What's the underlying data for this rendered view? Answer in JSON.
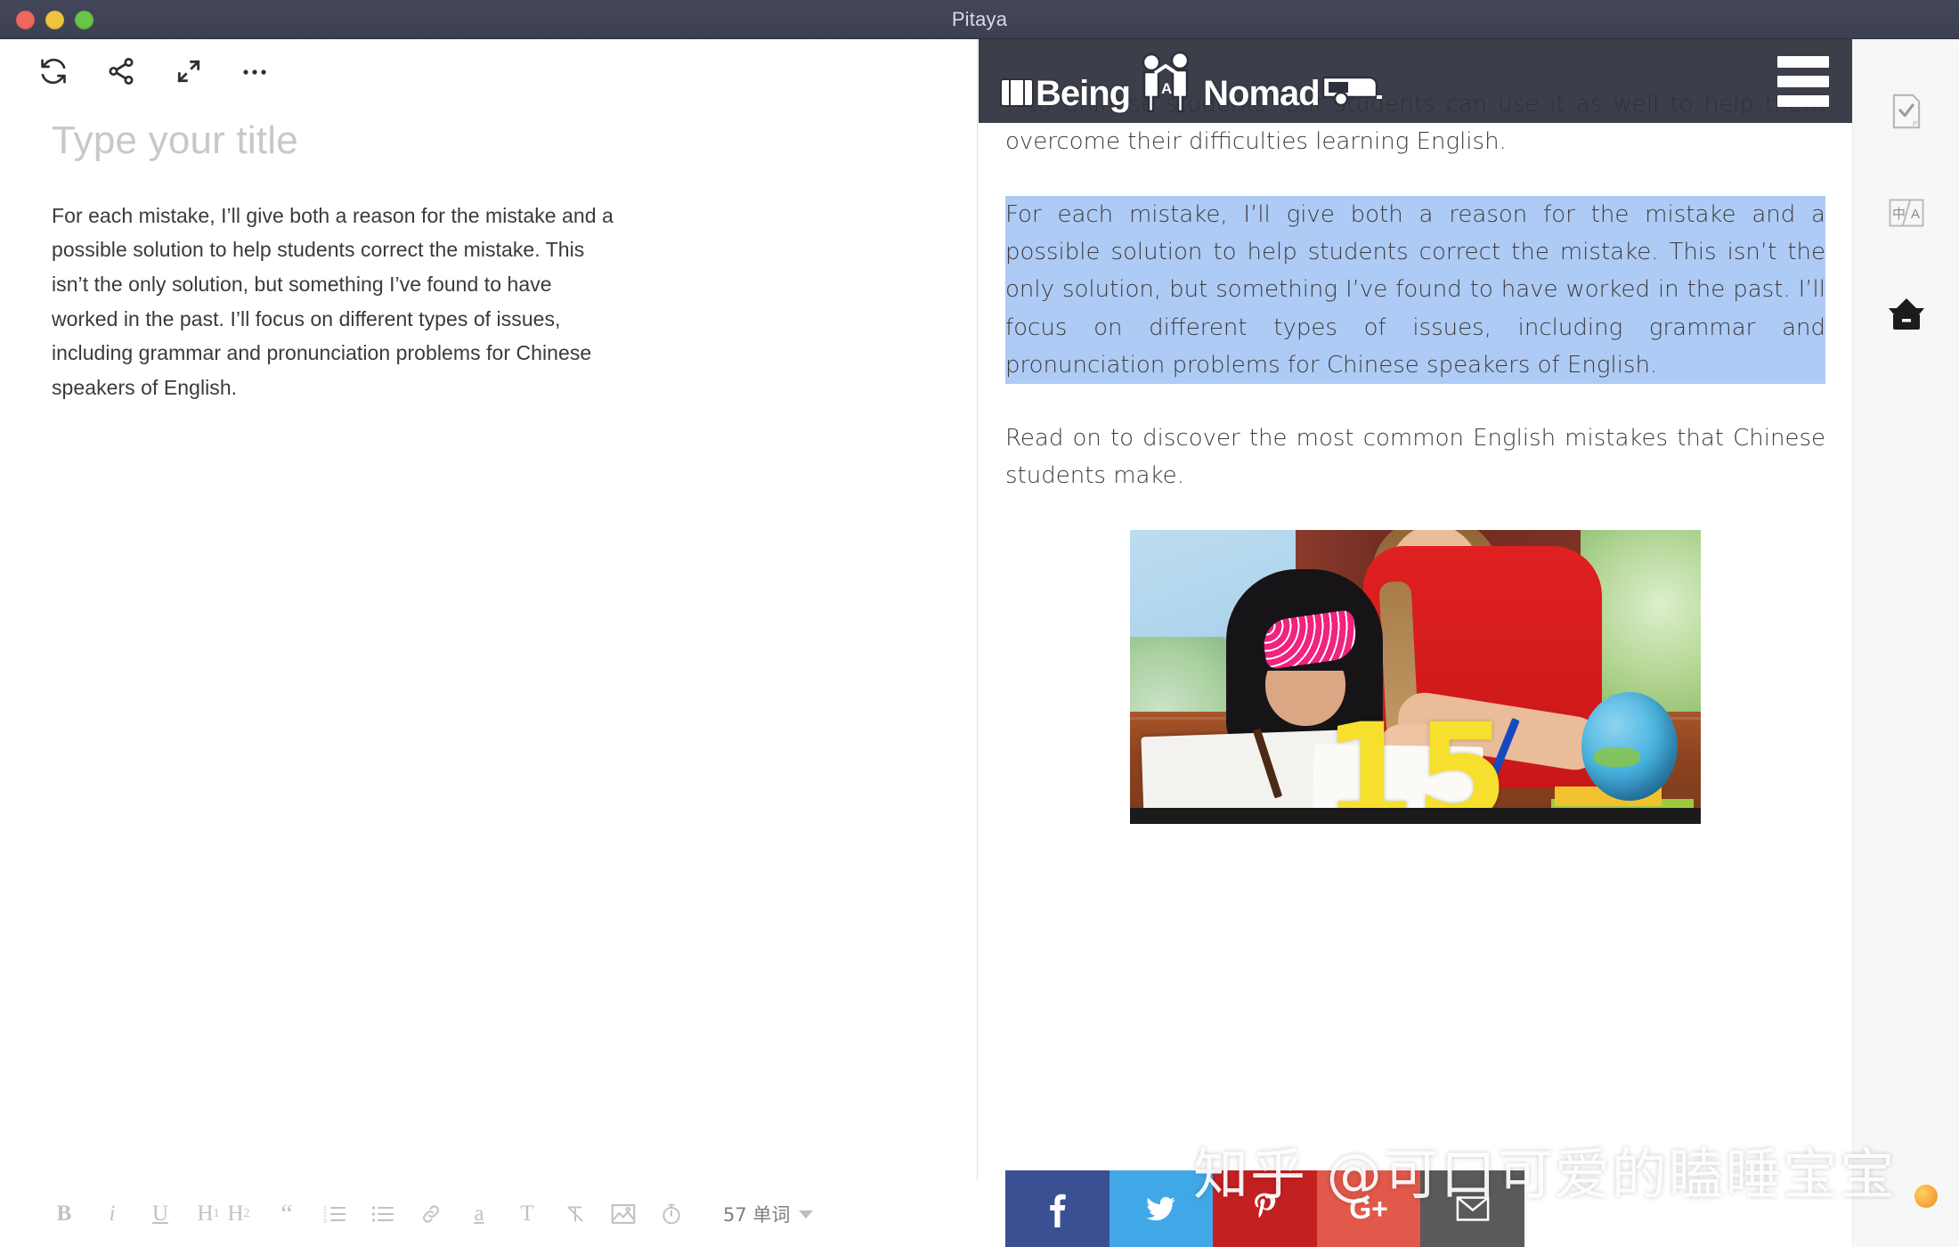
{
  "window": {
    "title": "Pitaya",
    "traffic_lights": [
      "close",
      "minimize",
      "zoom"
    ]
  },
  "editor": {
    "toolbar": [
      {
        "name": "sync-icon",
        "label": "Sync"
      },
      {
        "name": "share-icon",
        "label": "Share"
      },
      {
        "name": "fullscreen-icon",
        "label": "Fullscreen"
      },
      {
        "name": "more-icon",
        "label": "More"
      }
    ],
    "title_placeholder": "Type your title",
    "title_value": "",
    "paragraph": "For each mistake, I’ll give both a reason for the mistake and a possible solution to help students correct the mistake. This isn’t the only solution, but something I’ve found to have worked in the past. I’ll focus on different types of issues, including grammar and pronunciation problems for Chinese speakers of English."
  },
  "format_bar": {
    "items": [
      {
        "name": "bold-button",
        "label": "B"
      },
      {
        "name": "italic-button",
        "label": "i"
      },
      {
        "name": "underline-button",
        "label": "U"
      },
      {
        "name": "heading1-button",
        "label": "H1"
      },
      {
        "name": "heading2-button",
        "label": "H2"
      },
      {
        "name": "blockquote-button",
        "label": "“"
      },
      {
        "name": "ordered-list-button",
        "label": "ordered-list"
      },
      {
        "name": "bullet-list-button",
        "label": "bullet-list"
      },
      {
        "name": "link-button",
        "label": "link"
      },
      {
        "name": "strikethrough-button",
        "label": "a"
      },
      {
        "name": "text-style-button",
        "label": "T"
      },
      {
        "name": "clear-format-button",
        "label": "clear-format"
      },
      {
        "name": "insert-image-button",
        "label": "image"
      },
      {
        "name": "timer-button",
        "label": "timer"
      }
    ],
    "word_count": "57 单词"
  },
  "preview": {
    "site_header": {
      "logo_text_1": "Being",
      "logo_text_2": "Nomad",
      "logo_letter": "A",
      "menu_icon": "hamburger-icon"
    },
    "paragraphs": [
      {
        "id": "para-occluded",
        "text": "…to Chinese students. But students can use it as well to help them overcome their difficulties learning English.",
        "selected": false
      },
      {
        "id": "para-selected",
        "text": "For each mistake, I’ll give both a reason for the mistake and a possible solution to help students correct the mistake. This isn’t the only solution, but something I’ve found to have worked in the past. I’ll focus on different types of issues, including grammar and pronunciation problems for Chinese speakers of English.",
        "selected": true
      },
      {
        "id": "para-readon",
        "text": "Read on to discover the most common English mistakes that Chinese students make.",
        "selected": false
      }
    ],
    "figure": {
      "alt": "Teacher helping a young girl with her schoolwork at a desk with a globe",
      "overlay_number": "15"
    },
    "share_buttons": [
      {
        "name": "share-facebook",
        "label": "f",
        "color": "#3b5092"
      },
      {
        "name": "share-twitter",
        "label": "t",
        "color": "#41a8e8"
      },
      {
        "name": "share-pinterest",
        "label": "p",
        "color": "#c32121"
      },
      {
        "name": "share-googleplus",
        "label": "G+",
        "color": "#e2584a"
      },
      {
        "name": "share-email",
        "label": "✉",
        "color": "#5a5a5a"
      }
    ]
  },
  "watermark": {
    "text": "知乎 @可口可爱的瞌睡宝宝"
  },
  "right_rail": {
    "items": [
      {
        "name": "document-check-icon",
        "label": "Proofread"
      },
      {
        "name": "translate-icon",
        "label": "中/A"
      },
      {
        "name": "archive-icon",
        "label": "Archive"
      }
    ]
  },
  "colors": {
    "titlebar": "#3d4052",
    "selection": "#aecbf5",
    "header_overlay": "#2d303c",
    "rail_bg": "#f7f7f7"
  }
}
